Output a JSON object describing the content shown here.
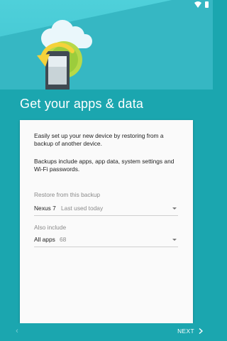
{
  "header": {
    "title": "Get your apps & data"
  },
  "card": {
    "paragraph1": "Easily set up your new device by restoring from a backup of another device.",
    "paragraph2": "Backups include apps, app data, system settings and Wi-Fi passwords.",
    "restore_label": "Restore from this backup",
    "restore_device": "Nexus 7",
    "restore_detail": "Last used today",
    "include_label": "Also include",
    "include_value": "All apps",
    "include_count": "68"
  },
  "nav": {
    "back_icon": "chevron-left-icon",
    "next_label": "NEXT",
    "next_icon": "chevron-right-icon"
  },
  "colors": {
    "accent": "#1ba6af",
    "header_top": "#4fd0da",
    "card": "#fafafa",
    "illustration_yellow": "#f5d23a",
    "illustration_green": "#9ccc3c"
  }
}
